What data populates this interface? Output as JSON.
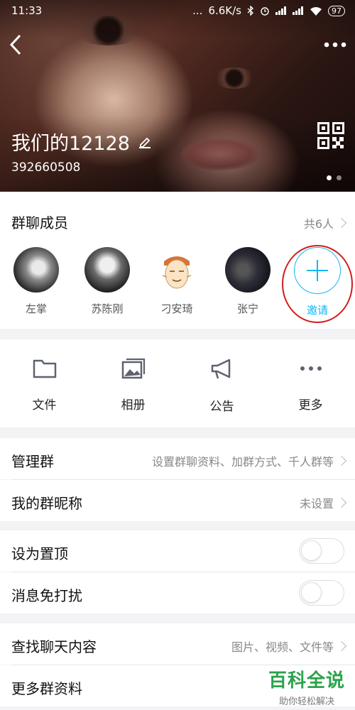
{
  "status_bar": {
    "time": "11:33",
    "dots": "...",
    "speed": "6.6K/s",
    "battery": "97"
  },
  "header": {
    "title": "我们的12128",
    "group_id": "392660508"
  },
  "members": {
    "title": "群聊成员",
    "count_label": "共6人",
    "items": [
      {
        "name": "左掌"
      },
      {
        "name": "苏陈刚"
      },
      {
        "name": "刁安琦"
      },
      {
        "name": "张宁"
      }
    ],
    "invite_label": "邀请"
  },
  "tools": [
    {
      "label": "文件",
      "icon": "folder-icon"
    },
    {
      "label": "相册",
      "icon": "photo-album-icon"
    },
    {
      "label": "公告",
      "icon": "megaphone-icon"
    },
    {
      "label": "更多",
      "icon": "more-dots-icon"
    }
  ],
  "rows": {
    "manage": {
      "label": "管理群",
      "value": "设置群聊资料、加群方式、千人群等"
    },
    "nickname": {
      "label": "我的群昵称",
      "value": "未设置"
    },
    "pin": {
      "label": "设为置顶"
    },
    "mute": {
      "label": "消息免打扰"
    },
    "search_history": {
      "label": "查找聊天内容",
      "value": "图片、视频、文件等"
    },
    "more_info": {
      "label": "更多群资料"
    }
  },
  "watermark": {
    "main": "百科全说",
    "sub": "助你轻松解决"
  },
  "colors": {
    "accent": "#12b7f5",
    "annotation_red": "#d21c1c",
    "watermark_green": "#2aa34a"
  }
}
